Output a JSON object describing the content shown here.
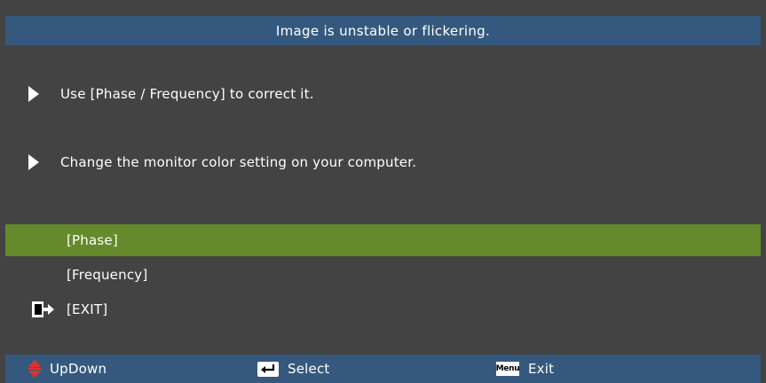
{
  "dialog": {
    "title": "Image is unstable or flickering.",
    "tips": [
      "Use [Phase / Frequency] to correct it.",
      "Change the monitor color setting on your computer."
    ]
  },
  "menu": {
    "items": [
      {
        "label": "[Phase]",
        "selected": true
      },
      {
        "label": "[Frequency]",
        "selected": false
      },
      {
        "label": "[EXIT]",
        "selected": false
      }
    ]
  },
  "footer": {
    "updown_label": "UpDown",
    "select_label": "Select",
    "menu_key_label": "Menu",
    "exit_label": "Exit"
  },
  "colors": {
    "title_bar": "#35597e",
    "panel": "#434343",
    "selected": "#658a2b",
    "updown_icon": "#e0312a"
  },
  "icons": {
    "tip_bullet": "triangle-right-icon",
    "exit": "exit-door-icon",
    "updown": "updown-arrows-icon",
    "select": "enter-key-icon",
    "menu": "menu-key-icon"
  }
}
